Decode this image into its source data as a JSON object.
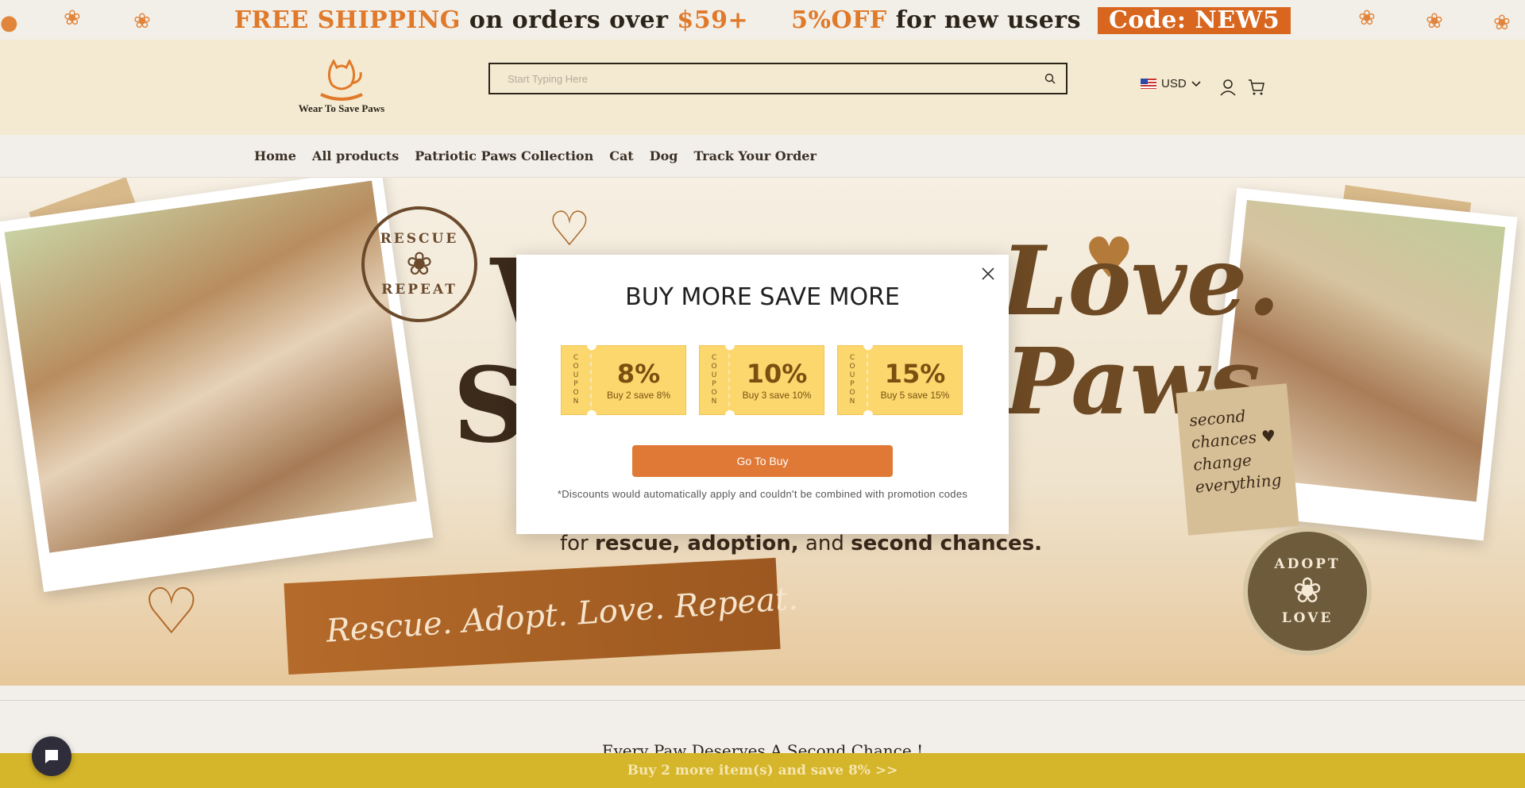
{
  "promo": {
    "free_shipping": "FREE SHIPPING",
    "on_orders_over": "on orders over",
    "threshold": "$59+",
    "discount": "5%OFF",
    "for_new_users": "for new users",
    "code": "Code: NEW5"
  },
  "header": {
    "logo_text": "Wear To Save Paws",
    "search_placeholder": "Start Typing Here",
    "currency": "USD"
  },
  "nav": {
    "items": [
      "Home",
      "All products",
      "Patriotic Paws Collection",
      "Cat",
      "Dog",
      "Track Your Order"
    ]
  },
  "hero": {
    "stamp_top": "RESCUE",
    "stamp_bottom": "REPEAT",
    "headline_left": "W",
    "headline_left2": "S",
    "headline_right": "Love.",
    "headline_right2": "Paws.",
    "sub_prefix": "for",
    "sub_rescue": "rescue, adoption,",
    "sub_and": "and",
    "sub_second": "second chances.",
    "banner_script": "Rescue. Adopt. Love. Repeat.",
    "note_text": "second chances ♥ change everything",
    "adopt_top": "ADOPT",
    "adopt_bottom": "LOVE"
  },
  "modal": {
    "title": "BUY MORE SAVE MORE",
    "coupon_side_letters": [
      "C",
      "O",
      "U",
      "P",
      "O",
      "N"
    ],
    "coupons": [
      {
        "percent": "8%",
        "desc": "Buy 2 save 8%"
      },
      {
        "percent": "10%",
        "desc": "Buy 3 save 10%"
      },
      {
        "percent": "15%",
        "desc": "Buy 5 save 15%"
      }
    ],
    "button_label": "Go To Buy",
    "note": "*Discounts would automatically apply and couldn't be combined with promotion codes"
  },
  "section": {
    "heading": "Every Paw Deserves A Second Chance !"
  },
  "bottom_bar": {
    "text": "Buy 2 more item(s) and save 8%  >>"
  },
  "colors": {
    "accent_orange": "#e07936",
    "coupon_yellow": "#fbd76e",
    "bottom_bar": "#d5b529",
    "chat_button": "#2f2d3a"
  }
}
